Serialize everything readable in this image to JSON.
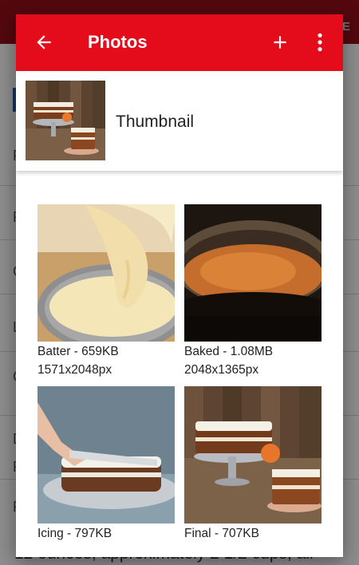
{
  "background": {
    "overflow_text": "12 ounces, approximately 2 1/2 cups, all-",
    "corner_letter": "E",
    "edge_letters": [
      "P",
      "P",
      "C",
      "L",
      "C",
      "D",
      "R",
      "P"
    ]
  },
  "dialog": {
    "toolbar": {
      "title": "Photos",
      "back_icon": "arrow-back-icon",
      "add_icon": "plus-icon",
      "more_icon": "more-vert-icon",
      "color": "#e40c1a"
    },
    "thumbnail": {
      "label": "Thumbnail"
    },
    "photos": [
      {
        "name_size": "Batter - 659KB",
        "dimensions": "1571x2048px"
      },
      {
        "name_size": "Baked - 1.08MB",
        "dimensions": "2048x1365px"
      },
      {
        "name_size": "Icing - 797KB",
        "dimensions": ""
      },
      {
        "name_size": "Final - 707KB",
        "dimensions": ""
      }
    ]
  }
}
